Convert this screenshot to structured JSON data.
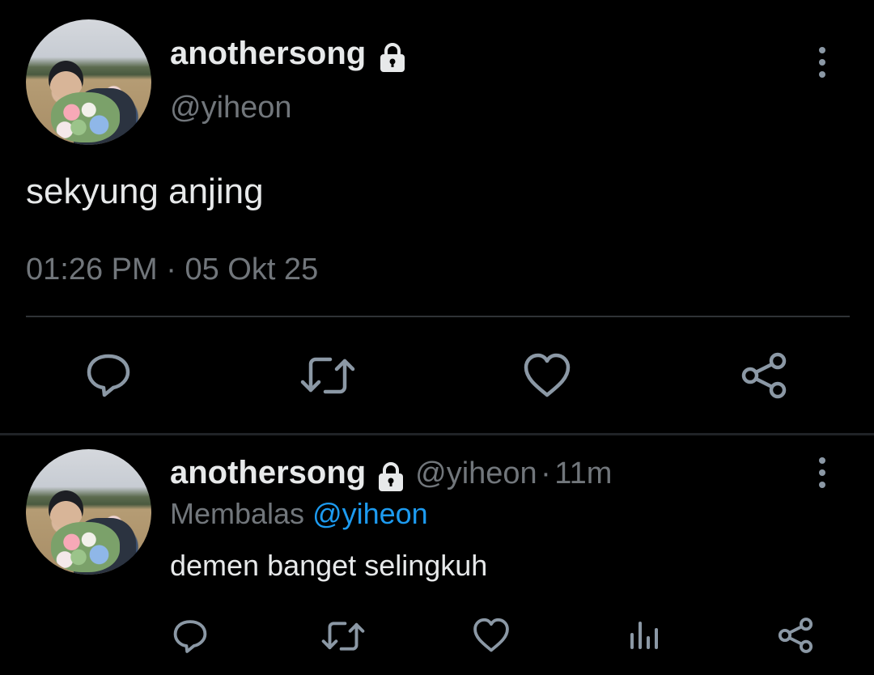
{
  "main_tweet": {
    "display_name": "anothersong",
    "handle": "@yiheon",
    "text": "sekyung anjing",
    "time": "01:26 PM",
    "separator": "·",
    "date": "05 Okt 25"
  },
  "reply_tweet": {
    "display_name": "anothersong",
    "handle": "@yiheon",
    "separator": "·",
    "age": "11m",
    "replying_prefix": "Membalas",
    "replying_to": "@yiheon",
    "text": "demen banget selingkuh"
  },
  "icons": {
    "lock": "lock-icon",
    "more": "more-vertical-icon",
    "reply": "reply-icon",
    "retweet": "retweet-icon",
    "like": "heart-icon",
    "share": "share-icon",
    "views": "views-icon"
  },
  "colors": {
    "background": "#000000",
    "text": "#e7e9ea",
    "muted": "#71767b",
    "accent": "#1d9bf0",
    "divider": "#2f3336",
    "icon": "#8b98a5"
  }
}
